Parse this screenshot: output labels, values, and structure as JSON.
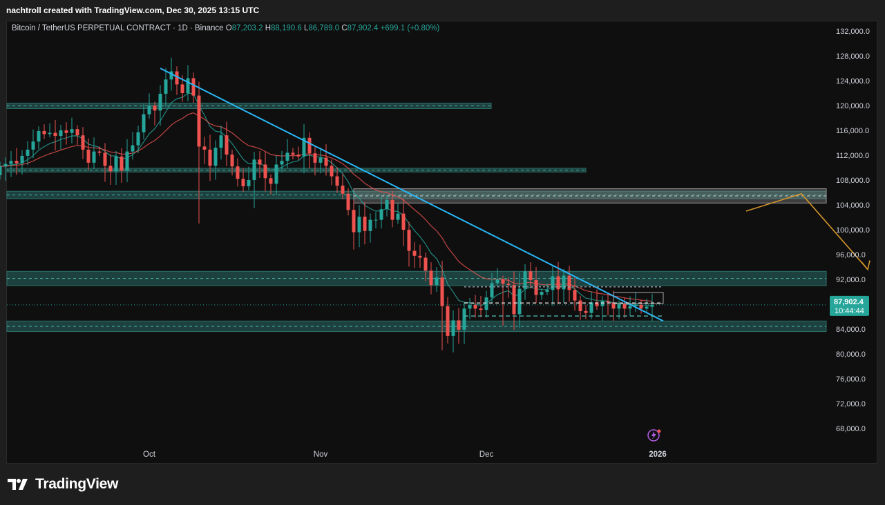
{
  "header": {
    "text": "nachtroll created with TradingView.com, Dec 30, 2025 13:15 UTC"
  },
  "legend": {
    "symbol": "Bitcoin / TetherUS PERPETUAL CONTRACT · 1D · Binance",
    "open_label": "O",
    "open": "87,203.2",
    "high_label": "H",
    "high": "88,190.6",
    "low_label": "L",
    "low": "86,789.0",
    "close_label": "C",
    "close": "87,902.4",
    "change": "+699.1 (+0.80%)"
  },
  "price_badge": {
    "price": "87,902.4",
    "countdown": "10:44:44"
  },
  "brand": {
    "name": "TradingView"
  },
  "colors": {
    "up": "#26a69a",
    "down": "#ef5350",
    "trendline": "#29b6f6",
    "arrow": "#d4952a",
    "zone": "#1f4a47"
  },
  "chart_data": {
    "type": "candlestick",
    "title": "Bitcoin / TetherUS PERPETUAL CONTRACT · 1D · Binance",
    "ylim": [
      64000,
      134000
    ],
    "y_ticks": [
      "132,000.0",
      "128,000.0",
      "124,000.0",
      "120,000.0",
      "116,000.0",
      "112,000.0",
      "108,000.0",
      "104,000.0",
      "100,000.0",
      "96,000.0",
      "92,000.0",
      "88,000.0",
      "84,000.0",
      "80,000.0",
      "76,000.0",
      "72,000.0",
      "68,000.0"
    ],
    "x_ticks": [
      {
        "label": "Oct",
        "day": 0
      },
      {
        "label": "Nov",
        "day": 31
      },
      {
        "label": "Dec",
        "day": 61
      },
      {
        "label": "2026",
        "day": 92
      }
    ],
    "x_range_days": [
      -27,
      131
    ],
    "last_price": 87902.4,
    "closes": [
      110200,
      110600,
      111100,
      110700,
      111900,
      112900,
      114200,
      115900,
      115400,
      115600,
      115100,
      116000,
      115600,
      116200,
      115200,
      112900,
      110800,
      112600,
      112400,
      110300,
      109400,
      111800,
      109500,
      112600,
      113600,
      115700,
      118600,
      120000,
      119200,
      121900,
      124200,
      125500,
      123400,
      122000,
      124400,
      121600,
      113400,
      112900,
      110300,
      113200,
      115200,
      112100,
      110200,
      108200,
      107000,
      108000,
      111300,
      110500,
      108300,
      107400,
      110500,
      111100,
      112400,
      112100,
      111800,
      114800,
      112300,
      110800,
      111600,
      110300,
      108600,
      107100,
      105800,
      103200,
      99600,
      102100,
      99800,
      101600,
      101600,
      103300,
      104800,
      101600,
      102600,
      100000,
      96600,
      95800,
      95500,
      93400,
      91100,
      92300,
      87700,
      82900,
      85400,
      83900,
      87300,
      87900,
      87300,
      87100,
      89100,
      91400,
      92000,
      91300,
      91100,
      86400,
      90500,
      93300,
      91900,
      89500,
      90000,
      90300,
      92500,
      90400,
      92600,
      90300,
      88600,
      86900,
      86600,
      88300,
      87700,
      88500,
      88300,
      87300,
      88000,
      87300,
      87700,
      87900,
      87300,
      87600,
      87900
    ],
    "series": [
      {
        "name": "",
        "role": "moving-average-fast",
        "color": "#26a69a"
      },
      {
        "name": "",
        "role": "moving-average-slow",
        "color": "#ef5350"
      }
    ],
    "zones": [
      {
        "low": 119500,
        "high": 120400
      },
      {
        "low": 109300,
        "high": 109900
      },
      {
        "low": 105000,
        "high": 106200
      },
      {
        "low": 91000,
        "high": 93300
      },
      {
        "low": 83600,
        "high": 85300
      },
      {
        "low": 104300,
        "high": 106600,
        "style": "grey"
      }
    ],
    "trendline": {
      "start": {
        "day": 2,
        "price": 126000
      },
      "end": {
        "day": 93,
        "price": 85300
      }
    },
    "projection_arrow": [
      {
        "day": 108,
        "price": 103000
      },
      {
        "day": 118,
        "price": 105800
      },
      {
        "day": 130,
        "price": 93600
      }
    ],
    "range_box": {
      "day_start": 57,
      "day_end": 93,
      "high": 90800,
      "mid": 88200,
      "low": 86100
    }
  }
}
